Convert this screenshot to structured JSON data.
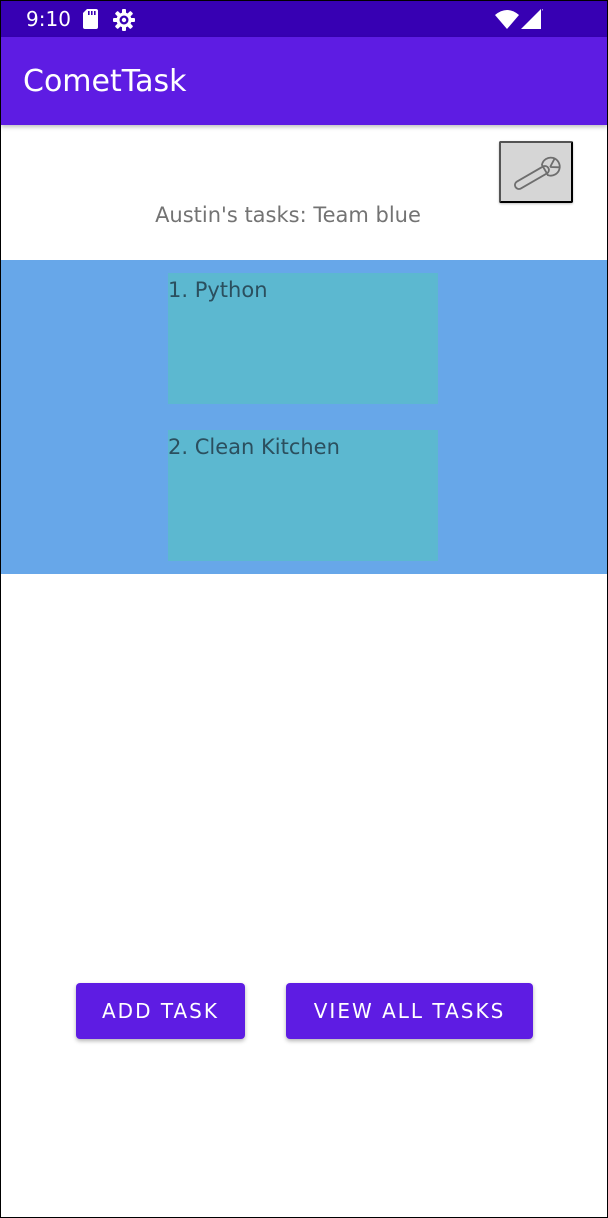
{
  "status_bar": {
    "time": "9:10",
    "icons": [
      "sd-card-icon",
      "settings-gear-icon",
      "wifi-icon",
      "cell-signal-icon"
    ]
  },
  "app_bar": {
    "title": "CometTask"
  },
  "header": {
    "settings_icon": "wrench-icon",
    "tasks_title": "Austin's tasks: Team blue"
  },
  "tasks": [
    {
      "label": "1. Python"
    },
    {
      "label": "2. Clean Kitchen"
    }
  ],
  "actions": {
    "add_task_label": "ADD TASK",
    "view_all_label": "VIEW ALL TASKS"
  },
  "colors": {
    "status_bar": "#3700b3",
    "app_bar": "#5e1ce3",
    "task_panel": "#67a7e9",
    "task_card": "#5cb8d0",
    "button": "#5e1ce3"
  }
}
